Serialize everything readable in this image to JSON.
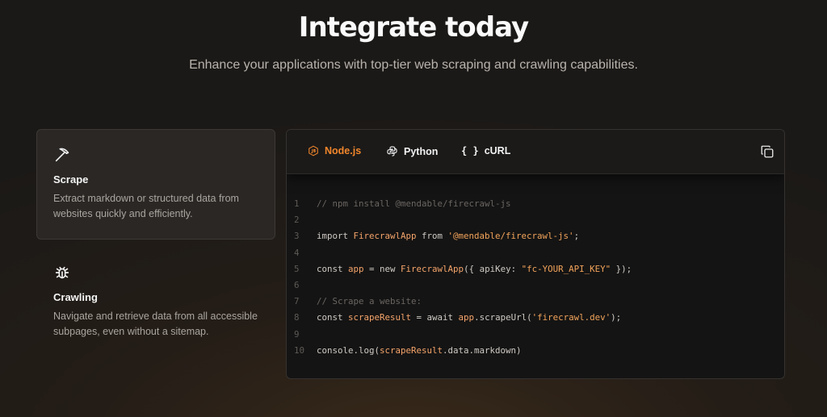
{
  "header": {
    "title": "Integrate today",
    "subtitle": "Enhance your applications with top-tier web scraping and crawling capabilities."
  },
  "features": [
    {
      "name": "Scrape",
      "icon": "pickaxe-icon",
      "description": "Extract markdown or structured data from websites quickly and efficiently."
    },
    {
      "name": "Crawling",
      "icon": "bug-icon",
      "description": "Navigate and retrieve data from all accessible subpages, even without a sitemap."
    }
  ],
  "tabs": {
    "node": "Node.js",
    "python": "Python",
    "curl": "cURL",
    "active": "Node.js"
  },
  "colors": {
    "accent": "#f2862b",
    "string": "#f2a35a",
    "comment": "#6a6561"
  },
  "code": {
    "lines": [
      "// npm install @mendable/firecrawl-js",
      "",
      "import FirecrawlApp from '@mendable/firecrawl-js';",
      "",
      "const app = new FirecrawlApp({ apiKey: \"fc-YOUR_API_KEY\" });",
      "",
      "// Scrape a website:",
      "const scrapeResult = await app.scrapeUrl('firecrawl.dev');",
      "",
      "console.log(scrapeResult.data.markdown)"
    ],
    "line_numbers": [
      "1",
      "2",
      "3",
      "4",
      "5",
      "6",
      "7",
      "8",
      "9",
      "10"
    ]
  }
}
